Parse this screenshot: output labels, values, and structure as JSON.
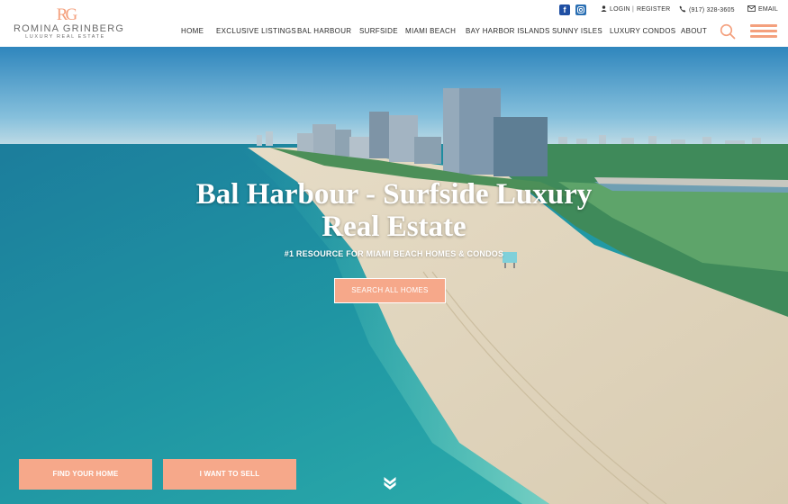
{
  "brand": {
    "monogram": "RG",
    "name": "ROMINA GRINBERG",
    "tagline": "LUXURY REAL ESTATE"
  },
  "topbar": {
    "social": [
      {
        "icon": "facebook-icon",
        "glyph": "f"
      },
      {
        "icon": "instagram-icon"
      }
    ],
    "login_label": "LOGIN",
    "separator": "|",
    "register_label": "REGISTER",
    "phone": "(917) 328-3605",
    "email_label": "EMAIL"
  },
  "nav": {
    "items": [
      {
        "label": "HOME"
      },
      {
        "label": "EXCLUSIVE LISTINGS"
      },
      {
        "label": "BAL HARBOUR"
      },
      {
        "label": "SURFSIDE"
      },
      {
        "label": "MIAMI BEACH"
      },
      {
        "label": "BAY HARBOR ISLANDS"
      },
      {
        "label": "SUNNY ISLES"
      },
      {
        "label": "LUXURY CONDOS"
      },
      {
        "label": "ABOUT"
      }
    ]
  },
  "hero": {
    "title_line1": "Bal Harbour - Surfside Luxury",
    "title_line2": "Real Estate",
    "subtitle": "#1 RESOURCE FOR MIAMI BEACH HOMES & CONDOS",
    "search_button": "SEARCH ALL HOMES",
    "find_button": "FIND YOUR HOME",
    "sell_button": "I WANT TO SELL"
  },
  "colors": {
    "accent": "#f6a88a",
    "logo": "#f4a07d",
    "facebook": "#1f4fa3",
    "instagram": "#2a6fb3"
  }
}
